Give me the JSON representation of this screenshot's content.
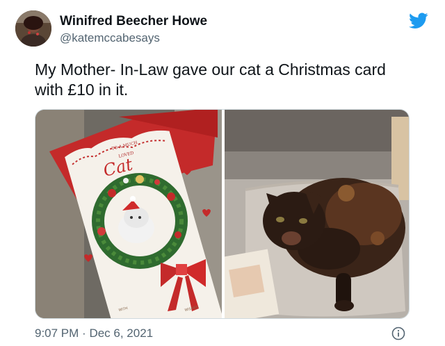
{
  "author": {
    "display_name": "Winifred Beecher Howe",
    "handle": "@katemccabesays"
  },
  "tweet": {
    "text": "My Mother- In-Law gave our cat a Christmas card with £10 in it."
  },
  "card": {
    "top_line_1": "TO A MUCH",
    "top_line_2": "LOVED",
    "main_word": "Cat",
    "bottom_left": "WITH",
    "bottom_right": "WISHES"
  },
  "timestamp": {
    "time": "9:07 PM",
    "separator": "·",
    "date": "Dec 6, 2021"
  },
  "colors": {
    "twitter_blue": "#1d9bf0",
    "text_primary": "#0f1419",
    "text_secondary": "#536471"
  },
  "icons": {
    "brand": "twitter-bird-icon",
    "info": "info-icon"
  }
}
